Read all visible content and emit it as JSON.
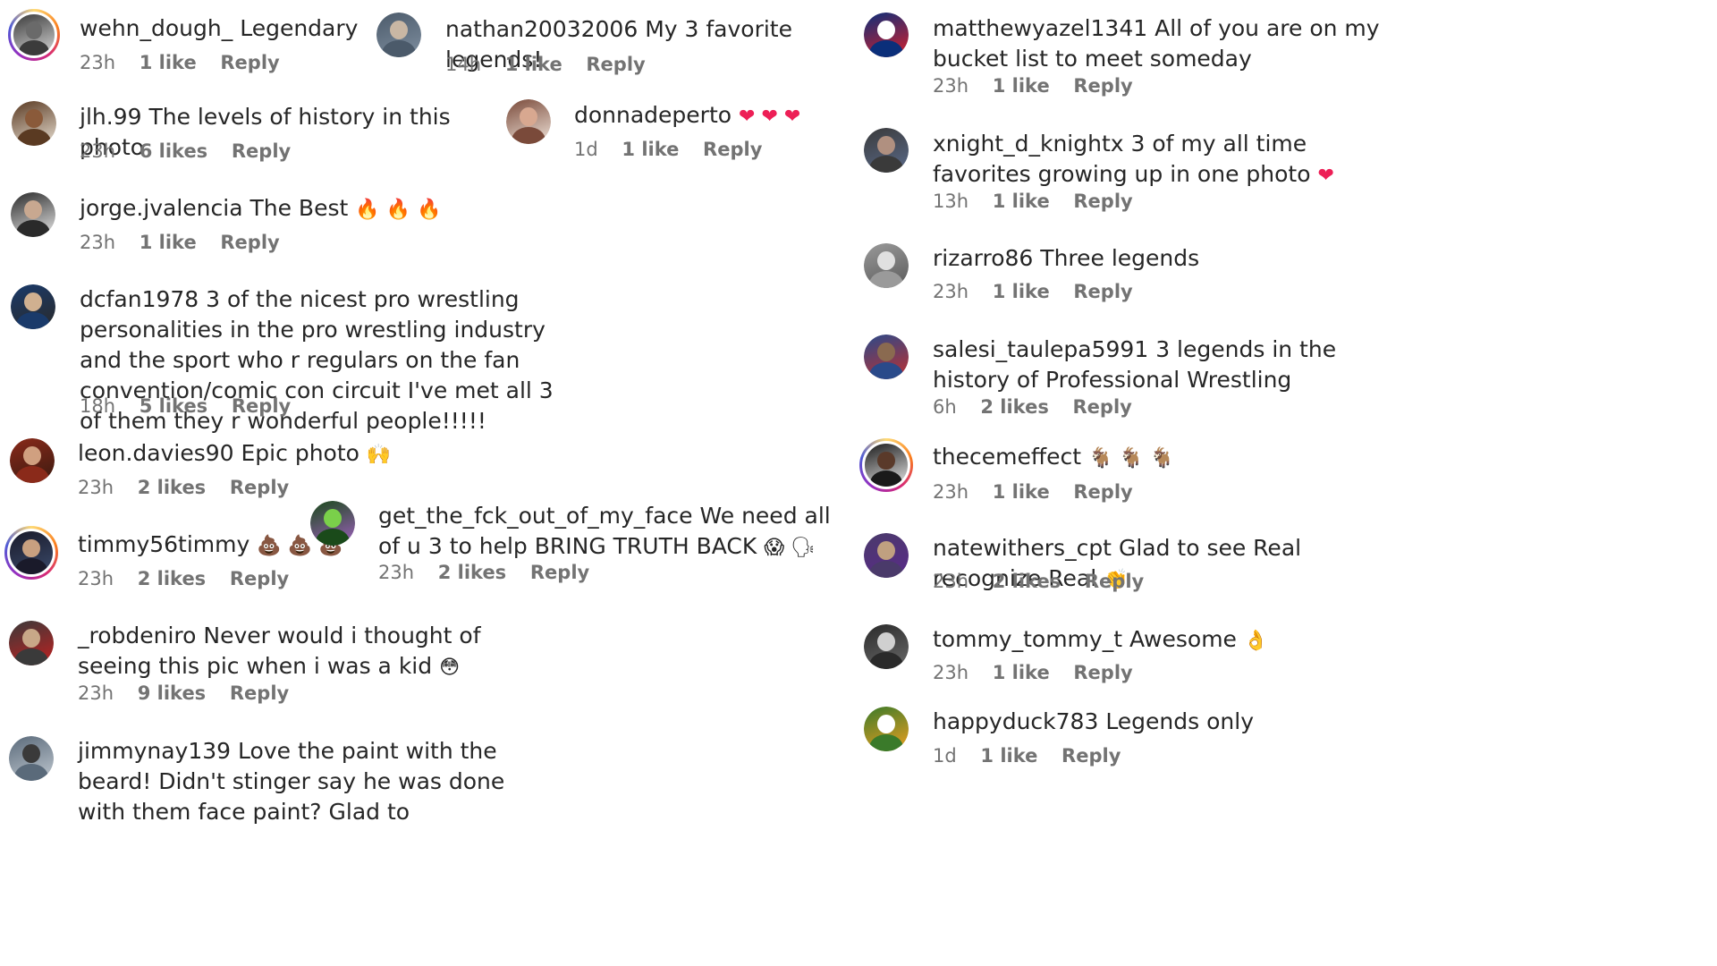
{
  "comments": [
    {
      "user": "wehn_dough_",
      "text": "Legendary",
      "time": "23h",
      "likes": "1 like",
      "reply": "Reply",
      "avatar_colors": [
        "#3b3b3b",
        "#6a6a6a",
        "#d7d7d7"
      ],
      "ring": true
    },
    {
      "user": "nathan20032006",
      "text": "My 3 favorite legends!",
      "time": "14h",
      "likes": "1 like",
      "reply": "Reply",
      "avatar_colors": [
        "#4b5a6a",
        "#c9b7a4",
        "#7f8fa0"
      ],
      "ring": false
    },
    {
      "user": "matthewyazel1341",
      "text": "All of you are on my bucket list to meet someday",
      "time": "23h",
      "likes": "1 like",
      "reply": "Reply",
      "avatar_colors": [
        "#0b2f7a",
        "#ffffff",
        "#d81e2a"
      ],
      "ring": false
    },
    {
      "user": "jlh.99",
      "text": "The levels of history in this photo",
      "time": "23h",
      "likes": "6 likes",
      "reply": "Reply",
      "avatar_colors": [
        "#5a3a22",
        "#8a5a3a",
        "#e8dfd2"
      ],
      "ring": false
    },
    {
      "user": "donnadeperto",
      "text": "",
      "emoji": "❤ ❤ ❤",
      "time": "1d",
      "likes": "1 like",
      "reply": "Reply",
      "avatar_colors": [
        "#7a4a3a",
        "#d8a890",
        "#f0e4da"
      ],
      "ring": false
    },
    {
      "user": "xnight_d_knightx",
      "text": "3 of my all time favorites growing up in one photo",
      "emoji": "❤",
      "time": "13h",
      "likes": "1 like",
      "reply": "Reply",
      "avatar_colors": [
        "#3a3a3a",
        "#b09080",
        "#5a6a8a"
      ],
      "ring": false
    },
    {
      "user": "jorge.jvalencia",
      "text": "The Best",
      "emoji": "🔥 🔥 🔥",
      "time": "23h",
      "likes": "1 like",
      "reply": "Reply",
      "avatar_colors": [
        "#2a2a2a",
        "#c8a890",
        "#e8e8e8"
      ],
      "ring": false
    },
    {
      "user": "rizarro86",
      "text": "Three legends",
      "time": "23h",
      "likes": "1 like",
      "reply": "Reply",
      "avatar_colors": [
        "#9a9a9a",
        "#e0e0e0",
        "#5a5a5a"
      ],
      "ring": false
    },
    {
      "user": "dcfan1978",
      "text": "3 of the nicest pro wrestling personalities in the pro wrestling industry and the sport who r regulars on the fan convention/comic con circuit I've met all 3 of them they r wonderful people!!!!!",
      "time": "18h",
      "likes": "5 likes",
      "reply": "Reply",
      "avatar_colors": [
        "#1a3a6a",
        "#d0b090",
        "#2a2a2a"
      ],
      "ring": false
    },
    {
      "user": "salesi_taulepa5991",
      "text": "3 legends in the history of Professional Wrestling",
      "time": "6h",
      "likes": "2 likes",
      "reply": "Reply",
      "avatar_colors": [
        "#2a4a8a",
        "#8a6a50",
        "#c03030"
      ],
      "ring": false
    },
    {
      "user": "leon.davies90",
      "text": "Epic photo",
      "emoji": "🙌",
      "time": "23h",
      "likes": "2 likes",
      "reply": "Reply",
      "avatar_colors": [
        "#8a2a1a",
        "#d0a080",
        "#3a1a10"
      ],
      "ring": false
    },
    {
      "user": "thecemeffect",
      "text": "",
      "emoji": "🐐 🐐 🐐",
      "time": "23h",
      "likes": "1 like",
      "reply": "Reply",
      "avatar_colors": [
        "#1a1a1a",
        "#5a3a2a",
        "#e8e8e8"
      ],
      "ring": true
    },
    {
      "user": "timmy56timmy",
      "text": "",
      "emoji": "💩 💩 💩",
      "time": "23h",
      "likes": "2 likes",
      "reply": "Reply",
      "avatar_colors": [
        "#1a1a2a",
        "#c8a080",
        "#3a4a6a"
      ],
      "ring": true
    },
    {
      "user": "get_the_fck_out_of_my_face",
      "text": "We need all of u 3 to help BRING TRUTH BACK",
      "emoji": "😱 🗣",
      "time": "23h",
      "likes": "2 likes",
      "reply": "Reply",
      "avatar_colors": [
        "#1a4a1a",
        "#7ad04a",
        "#a060c0"
      ],
      "ring": false
    },
    {
      "user": "natewithers_cpt",
      "text": "Glad to see Real recognize Real",
      "emoji": "👏",
      "time": "23h",
      "likes": "2 likes",
      "reply": "Reply",
      "avatar_colors": [
        "#4a3a6a",
        "#c0a080",
        "#5a2a8a"
      ],
      "ring": false
    },
    {
      "user": "_robdeniro",
      "text": "Never would i thought of seeing this pic when i was a kid",
      "emoji": "😳",
      "time": "23h",
      "likes": "9 likes",
      "reply": "Reply",
      "avatar_colors": [
        "#3a3a3a",
        "#c8a888",
        "#c02020"
      ],
      "ring": false
    },
    {
      "user": "tommy_tommy_t",
      "text": "Awesome",
      "emoji": "👌",
      "time": "23h",
      "likes": "1 like",
      "reply": "Reply",
      "avatar_colors": [
        "#2a2a2a",
        "#d0d0d0",
        "#6a6a6a"
      ],
      "ring": false
    },
    {
      "user": "jimmynay139",
      "text": "Love the paint with the beard! Didn't stinger say he was done with them face paint? Glad to",
      "time": "",
      "likes": "",
      "reply": "",
      "avatar_colors": [
        "#5a6a7a",
        "#3a3a3a",
        "#c0c8d0"
      ],
      "ring": false
    },
    {
      "user": "happyduck783",
      "text": "Legends only",
      "time": "1d",
      "likes": "1 like",
      "reply": "Reply",
      "avatar_colors": [
        "#3a7a2a",
        "#ffffff",
        "#f0a020"
      ],
      "ring": false
    }
  ]
}
